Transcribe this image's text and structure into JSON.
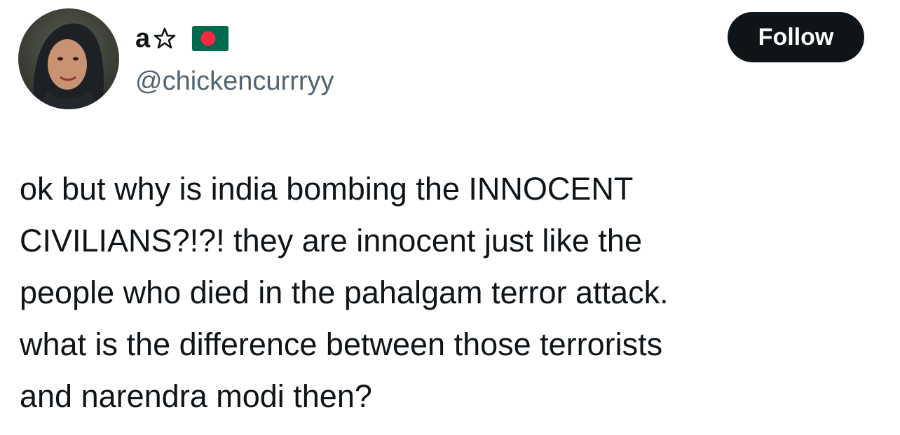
{
  "author": {
    "display_name": "a",
    "handle": "@chickencurrryy",
    "name_icons": [
      "star-outline-icon",
      "bangladesh-flag-icon"
    ]
  },
  "actions": {
    "follow_label": "Follow"
  },
  "tweet": {
    "lines": [
      "ok but why is india bombing the INNOCENT",
      "CIVILIANS?!?! they are innocent just like the",
      "people who died in the pahalgam terror attack.",
      "what is the difference between those terrorists",
      "and narendra modi then?"
    ]
  },
  "colors": {
    "text_primary": "#0f1419",
    "text_secondary": "#536471",
    "button_bg": "#0f1419",
    "button_text": "#ffffff",
    "flag_green": "#006a4e",
    "flag_red": "#f42a41"
  }
}
